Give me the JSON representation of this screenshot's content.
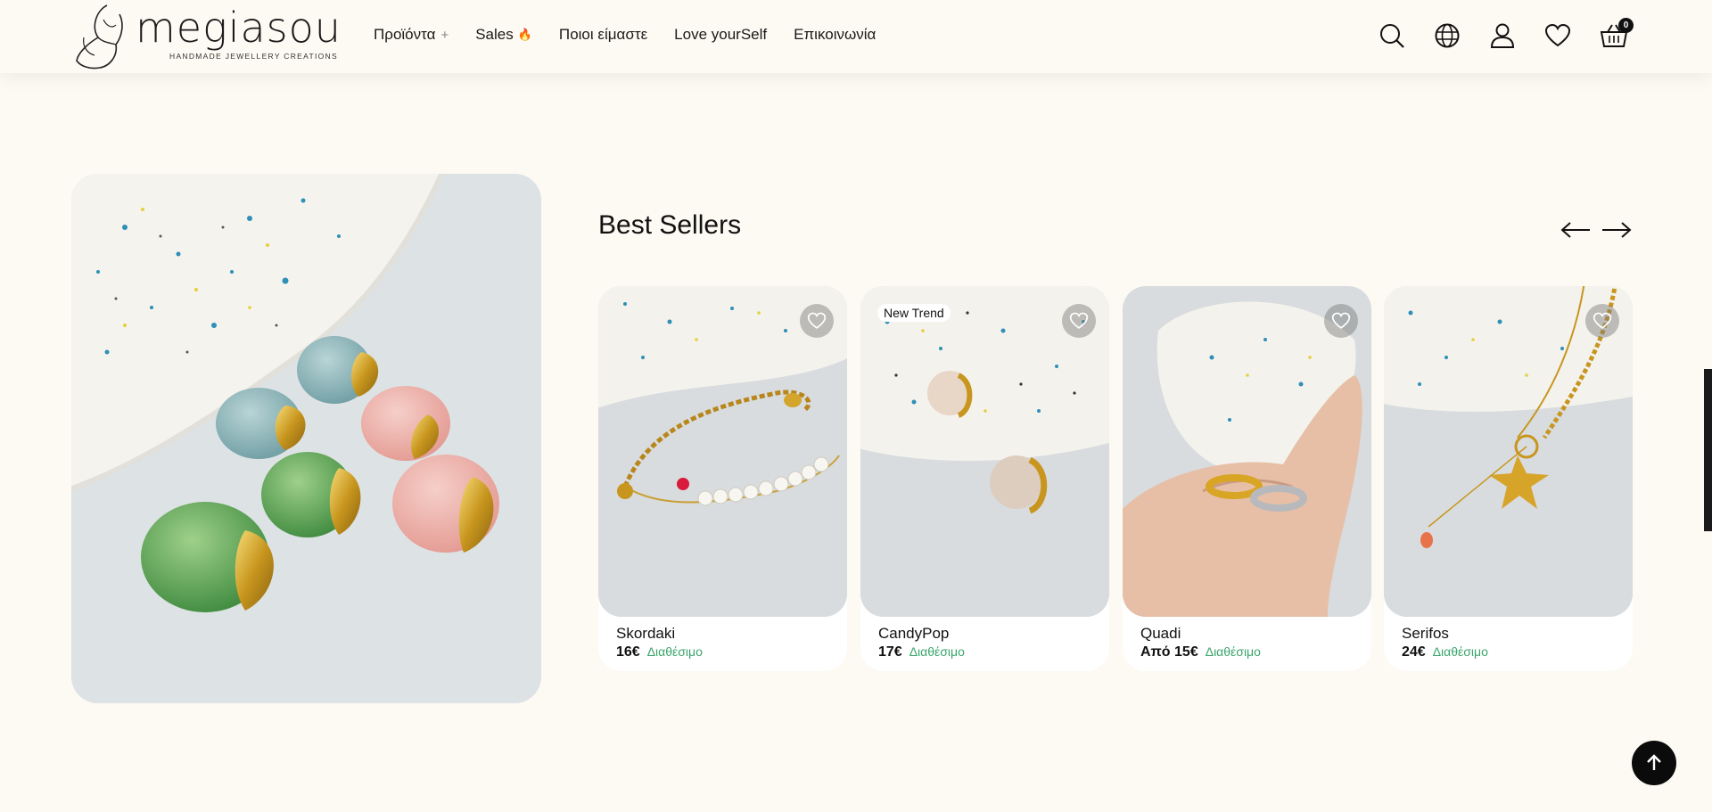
{
  "brand": {
    "name": "megiasou",
    "tagline": "HANDMADE JEWELLERY CREATIONS"
  },
  "nav": {
    "items": [
      {
        "label": "Προϊόντα",
        "suffix": "+"
      },
      {
        "label": "Sales",
        "suffix": "🔥"
      },
      {
        "label": "Ποιοι είμαστε"
      },
      {
        "label": "Love yourSelf"
      },
      {
        "label": "Επικοινωνία"
      }
    ]
  },
  "header_icons": [
    "search-icon",
    "globe-icon",
    "user-icon",
    "heart-icon",
    "basket-icon"
  ],
  "cart": {
    "count": "0"
  },
  "section": {
    "title": "Best Sellers"
  },
  "products": [
    {
      "name": "Skordaki",
      "price": "16€",
      "stock": "Διαθέσιμο",
      "badge": ""
    },
    {
      "name": "CandyPop",
      "price": "17€",
      "stock": "Διαθέσιμο",
      "badge": "New Trend"
    },
    {
      "name": "Quadi",
      "price": "Από 15€",
      "stock": "Διαθέσιμο",
      "badge": ""
    },
    {
      "name": "Serifos",
      "price": "24€",
      "stock": "Διαθέσιμο",
      "badge": ""
    }
  ],
  "colors": {
    "background": "#fdf9f3",
    "available": "#3aa56b",
    "dark": "#0b0b0b"
  }
}
